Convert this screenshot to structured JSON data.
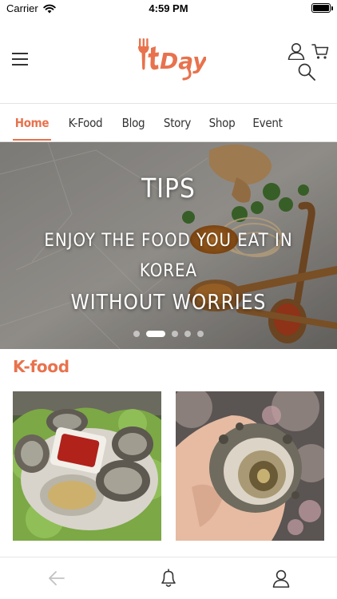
{
  "status_bar": {
    "carrier": "Carrier",
    "time": "4:59 PM"
  },
  "header": {
    "logo_text": "ItDay",
    "icons": [
      "menu-icon",
      "user-icon",
      "cart-icon",
      "search-icon"
    ]
  },
  "nav": {
    "tabs": [
      {
        "label": "Home",
        "active": true
      },
      {
        "label": "K-Food",
        "active": false
      },
      {
        "label": "Blog",
        "active": false
      },
      {
        "label": "Story",
        "active": false
      },
      {
        "label": "Shop",
        "active": false
      },
      {
        "label": "Event",
        "active": false
      }
    ]
  },
  "hero": {
    "title": "TIPS",
    "line1": "ENJOY THE FOOD YOU EAT IN KOREA",
    "line2": "WITHOUT WORRIES",
    "slide_count": 5,
    "active_slide": 2
  },
  "section": {
    "title": "K-food"
  },
  "bottom_bar": {
    "icons": [
      "back-arrow-icon",
      "bell-icon",
      "user-icon"
    ]
  },
  "colors": {
    "accent": "#e8724d",
    "text": "#333333",
    "divider": "#e3e3e3"
  }
}
